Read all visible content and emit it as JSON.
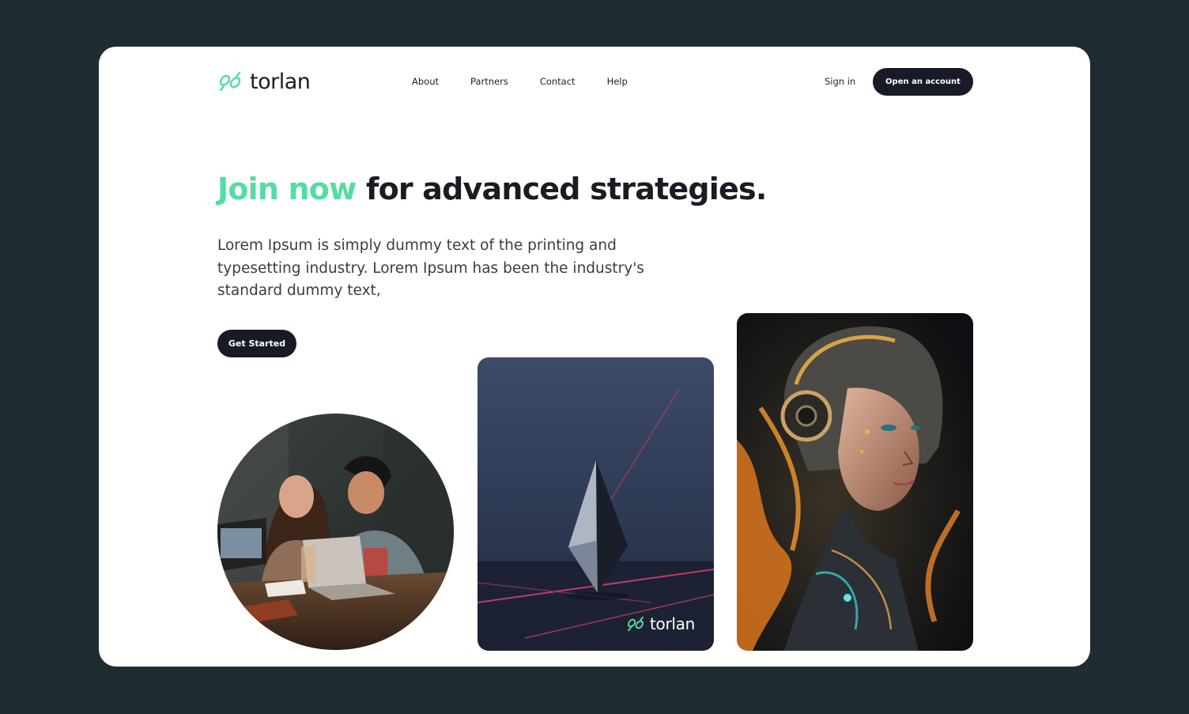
{
  "brand": {
    "name": "torlan",
    "accent_color": "#55dca2",
    "dark_color": "#181a25"
  },
  "nav": {
    "items": [
      "About",
      "Partners",
      "Contact",
      "Help"
    ]
  },
  "auth": {
    "sign_in": "Sign in",
    "open_account": "Open an account"
  },
  "hero": {
    "headline_accent": "Join now",
    "headline_rest": " for advanced strategies.",
    "description": "Lorem Ipsum is simply dummy text of the printing and typesetting industry. Lorem Ipsum has been the industry's standard dummy text,",
    "cta": "Get Started"
  },
  "images": {
    "circle": "people-laptops-photo",
    "middle": "crystal-shape-render",
    "right": "cyborg-woman-artwork"
  },
  "icons": {
    "logo": "torlan-logo-icon"
  }
}
